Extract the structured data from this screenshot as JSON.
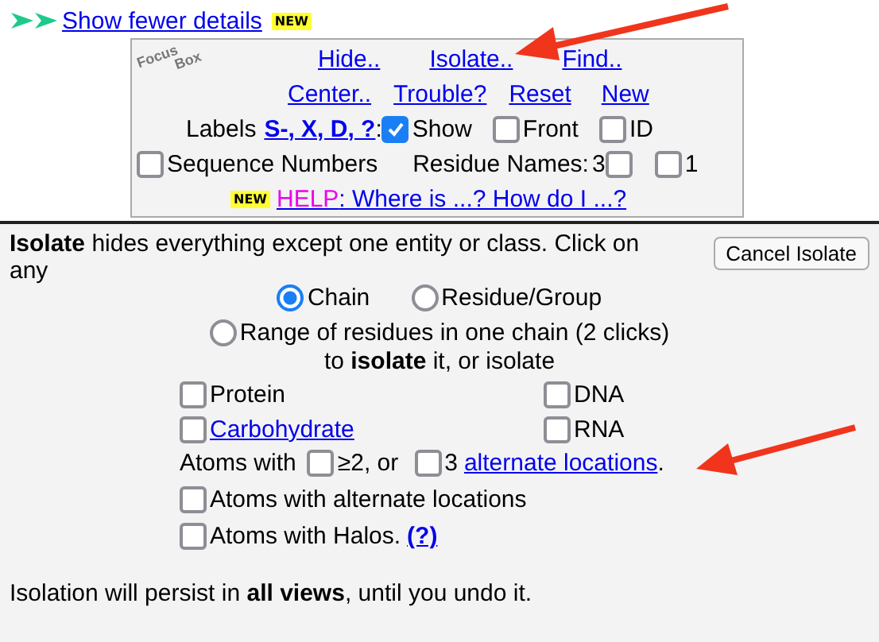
{
  "details_link": {
    "label": "Show fewer details",
    "badge": "NEW"
  },
  "focus_box": {
    "logo": [
      "Focus",
      "Box"
    ],
    "links_row1": [
      "Hide..",
      "Isolate..",
      "Find.."
    ],
    "links_row2": [
      "Center..",
      "Trouble?",
      "Reset",
      "New"
    ],
    "labels": {
      "label": "Labels",
      "link": "S-, X, D, ?",
      "separator": ":",
      "options": [
        {
          "label": "Show",
          "checked": true
        },
        {
          "label": "Front",
          "checked": false
        },
        {
          "label": "ID",
          "checked": false
        }
      ]
    },
    "sequence_numbers": {
      "label": "Sequence Numbers",
      "checked": false
    },
    "residue_names": {
      "label": "Residue Names:",
      "options": [
        {
          "label": "3",
          "kind": "label_first",
          "checked": false
        },
        {
          "label": "1",
          "kind": "box_first",
          "checked": false
        }
      ]
    },
    "help": {
      "badge": "NEW",
      "title": "HELP",
      "text": ": Where is ...? How do I ...?"
    }
  },
  "isolate_panel": {
    "intro": "**Isolate** hides everything except one entity or class. Click on any",
    "cancel_button": "Cancel Isolate",
    "modes": [
      {
        "label": "Chain",
        "selected": true
      },
      {
        "label": "Residue/Group",
        "selected": false
      },
      {
        "label": "Range of residues in one chain (2 clicks)",
        "selected": false
      }
    ],
    "modes_note": "to **isolate** it, or isolate",
    "classes": [
      {
        "label": "Protein",
        "kind": "plain",
        "checked": false
      },
      {
        "label": "DNA",
        "kind": "plain",
        "checked": false
      },
      {
        "label": "Carbohydrate",
        "kind": "link",
        "checked": false
      },
      {
        "label": "RNA",
        "kind": "plain",
        "checked": false
      }
    ],
    "alternate": {
      "label": "Atoms with",
      "options": [
        {
          "label": "≥2",
          "checked": false
        },
        {
          "label": "3",
          "checked": false
        }
      ],
      "joiner": ", or",
      "link": "alternate locations",
      "end": "."
    },
    "extra": [
      {
        "label": "Atoms with alternate locations",
        "checked": false
      },
      {
        "label": "Atoms with Halos.",
        "link": "(?)",
        "checked": false
      }
    ],
    "footer": "Isolation will persist in **all views**, until you undo it."
  }
}
